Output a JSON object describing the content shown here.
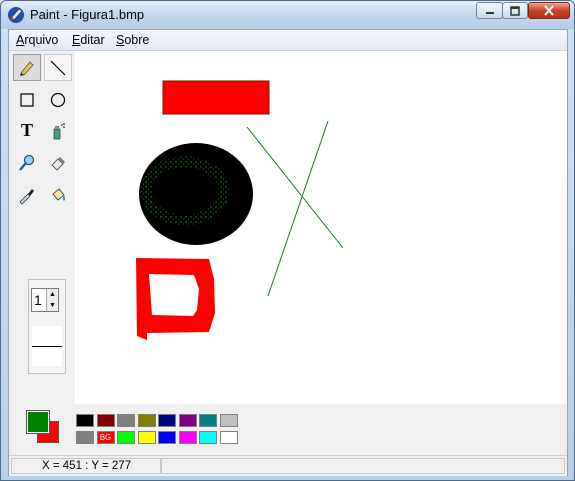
{
  "window": {
    "title": "Paint - Figura1.bmp",
    "app_icon": "paint-app-icon"
  },
  "menu": [
    {
      "label": "Arquivo",
      "underline": "A",
      "rest": "rquivo"
    },
    {
      "label": "Editar",
      "underline": "E",
      "rest": "ditar"
    },
    {
      "label": "Sobre",
      "underline": "S",
      "rest": "obre"
    }
  ],
  "tools": [
    {
      "name": "pencil",
      "icon": "pencil-icon",
      "selected": true
    },
    {
      "name": "line",
      "icon": "line-icon"
    },
    {
      "name": "rectangle",
      "icon": "rectangle-icon"
    },
    {
      "name": "ellipse",
      "icon": "ellipse-icon"
    },
    {
      "name": "text",
      "icon": "text-icon",
      "glyph": "T"
    },
    {
      "name": "spray",
      "icon": "spray-icon"
    },
    {
      "name": "magnifier",
      "icon": "magnifier-icon"
    },
    {
      "name": "eraser",
      "icon": "eraser-icon"
    },
    {
      "name": "color-picker",
      "icon": "eyedropper-icon"
    },
    {
      "name": "fill",
      "icon": "fill-bucket-icon"
    }
  ],
  "line_width": {
    "value": "1"
  },
  "colors": {
    "foreground": "#008000",
    "background": "#ff0000"
  },
  "palette": {
    "row1": [
      "#000000",
      "#800000",
      "#808080",
      "#808000",
      "#000080",
      "#800080",
      "#008080",
      "#c0c0c0"
    ],
    "row2": [
      "#808080",
      "#ff0000",
      "#00ff00",
      "#ffff00",
      "#0000ff",
      "#ff00ff",
      "#00ffff",
      "#ffffff"
    ],
    "row1_labels": [
      "",
      "",
      "",
      "",
      "",
      "",
      "",
      ""
    ],
    "row2_labels": [
      "",
      "BG",
      "",
      "",
      "",
      "",
      "",
      ""
    ]
  },
  "status": {
    "coords": "X = 451 : Y = 277",
    "extra": ""
  }
}
